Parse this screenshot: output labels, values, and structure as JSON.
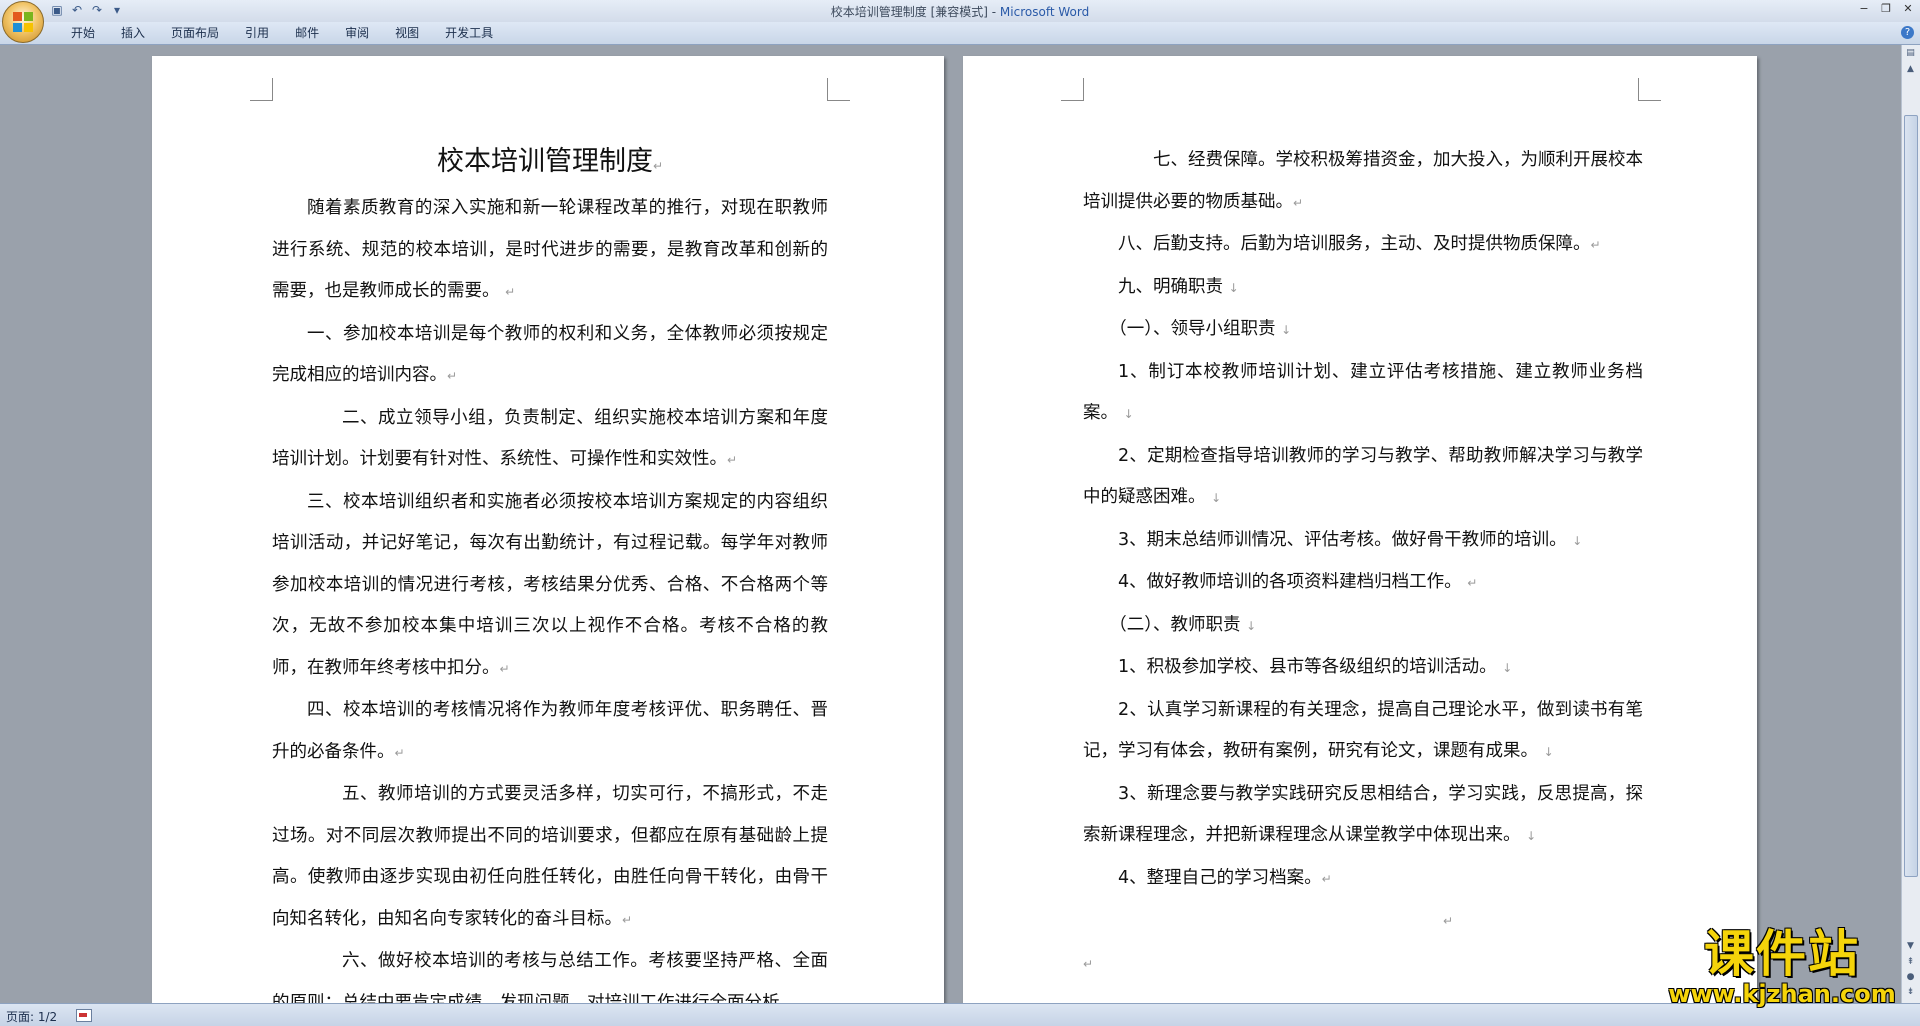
{
  "window": {
    "doc_title": "校本培训管理制度 [兼容模式] - ",
    "app_name": "Microsoft Word",
    "controls": [
      "−",
      "❐",
      "✕"
    ]
  },
  "quick_access": [
    "save-icon",
    "undo-icon",
    "redo-icon",
    "customize-icon"
  ],
  "ribbon": {
    "tabs": [
      "开始",
      "插入",
      "页面布局",
      "引用",
      "邮件",
      "审阅",
      "视图",
      "开发工具"
    ]
  },
  "page1": {
    "heading": "校本培训管理制度",
    "paragraphs": [
      "随着素质教育的深入实施和新一轮课程改革的推行，对现在职教师进行系统、规范的校本培训，是时代进步的需要，是教育改革和创新的需要，也是教师成长的需要。",
      "一、参加校本培训是每个教师的权利和义务，全体教师必须按规定完成相应的培训内容。",
      "二、成立领导小组，负责制定、组织实施校本培训方案和年度培训计划。计划要有针对性、系统性、可操作性和实效性。",
      "三、校本培训组织者和实施者必须按校本培训方案规定的内容组织培训活动，并记好笔记，每次有出勤统计，有过程记载。每学年对教师参加校本培训的情况进行考核，考核结果分优秀、合格、不合格两个等次，无故不参加校本集中培训三次以上视作不合格。考核不合格的教师，在教师年终考核中扣分。",
      "四、校本培训的考核情况将作为教师年度考核评优、职务聘任、晋升的必备条件。",
      "五、教师培训的方式要灵活多样，切实可行，不搞形式，不走过场。对不同层次教师提出不同的培训要求，但都应在原有基础龄上提高。使教师由逐步实现由初任向胜任转化，由胜任向骨干转化，由骨干向知名转化，由知名向专家转化的奋斗目标。",
      "六、做好校本培训的考核与总结工作。考核要坚持严格、全面的原则；总结中要肯定成绩，发现问题，对培训工作进行全面分析，"
    ]
  },
  "page2": {
    "paragraphs": [
      "七、经费保障。学校积极筹措资金，加大投入，为顺利开展校本培训提供必要的物质基础。",
      "八、后勤支持。后勤为培训服务，主动、及时提供物质保障。",
      "九、明确职责",
      "（一）、领导小组职责",
      "1、制订本校教师培训计划、建立评估考核措施、建立教师业务档案。",
      "2、定期检查指导培训教师的学习与教学、帮助教师解决学习与教学中的疑惑困难。",
      "3、期末总结师训情况、评估考核。做好骨干教师的培训。",
      "4、做好教师培训的各项资料建档归档工作。",
      "（二）、教师职责",
      "1、积极参加学校、县市等各级组织的培训活动。",
      "2、认真学习新课程的有关理念，提高自己理论水平，做到读书有笔记，学习有体会，教研有案例，研究有论文，课题有成果。",
      "3、新理念要与教学实践研究反思相结合，学习实践，反思提高，探索新课程理念，并把新课程理念从课堂教学中体现出来。",
      "4、整理自己的学习档案。"
    ]
  },
  "status_bar": {
    "page_indicator": "页面: 1/2"
  },
  "watermark": {
    "title": "课件站",
    "url": "www.kjzhan.com"
  }
}
